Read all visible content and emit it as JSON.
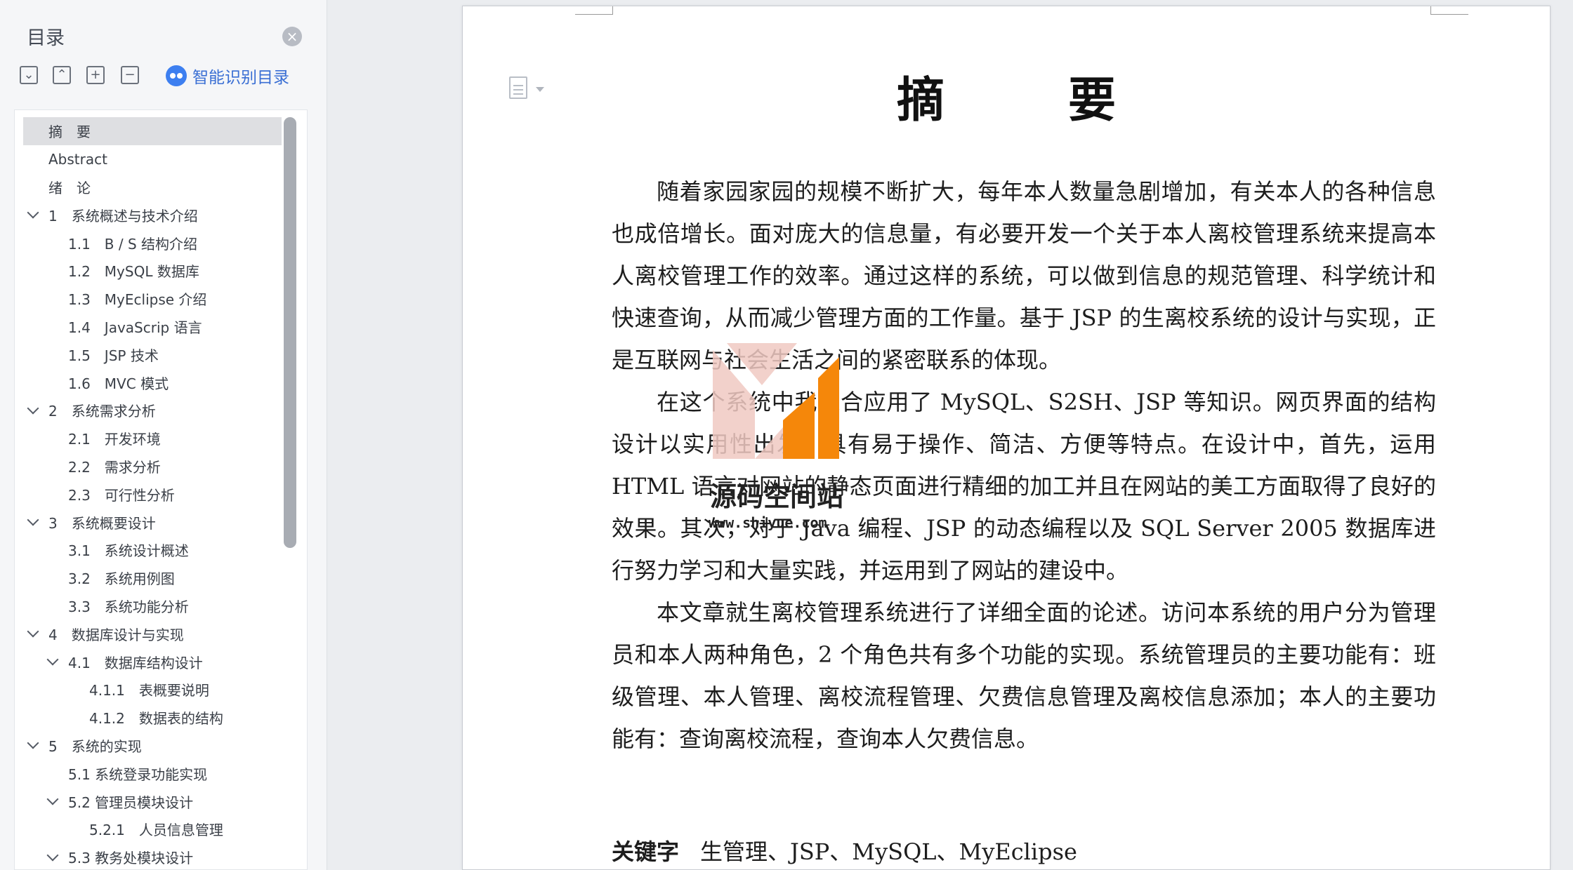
{
  "sidebar": {
    "title": "目录",
    "close_icon": "close-circle-icon",
    "tools": [
      {
        "name": "collapse-all-button",
        "glyph": "⌄"
      },
      {
        "name": "expand-all-button",
        "glyph": "⌃"
      },
      {
        "name": "zoom-in-button",
        "glyph": "+"
      },
      {
        "name": "zoom-out-button",
        "glyph": "−"
      }
    ],
    "smart_toc_label": "智能识别目录",
    "toc": [
      {
        "label": "摘　要",
        "level": 0,
        "chevron": false,
        "selected": true
      },
      {
        "label": "Abstract",
        "level": 0,
        "chevron": false
      },
      {
        "label": "绪　论",
        "level": 0,
        "chevron": false
      },
      {
        "label": "1　系统概述与技术介绍",
        "level": 0,
        "chevron": true
      },
      {
        "label": "1.1　B / S 结构介绍",
        "level": 1,
        "chevron": false
      },
      {
        "label": "1.2　MySQL 数据库",
        "level": 1,
        "chevron": false
      },
      {
        "label": "1.3　MyEclipse 介绍",
        "level": 1,
        "chevron": false
      },
      {
        "label": "1.4　JavaScrip 语言",
        "level": 1,
        "chevron": false
      },
      {
        "label": "1.5　JSP 技术",
        "level": 1,
        "chevron": false
      },
      {
        "label": "1.6　MVC 模式",
        "level": 1,
        "chevron": false
      },
      {
        "label": "2　系统需求分析",
        "level": 0,
        "chevron": true
      },
      {
        "label": "2.1　开发环境",
        "level": 1,
        "chevron": false
      },
      {
        "label": "2.2　需求分析",
        "level": 1,
        "chevron": false
      },
      {
        "label": "2.3　可行性分析",
        "level": 1,
        "chevron": false
      },
      {
        "label": "3　系统概要设计",
        "level": 0,
        "chevron": true
      },
      {
        "label": "3.1　系统设计概述",
        "level": 1,
        "chevron": false
      },
      {
        "label": "3.2　系统用例图",
        "level": 1,
        "chevron": false
      },
      {
        "label": "3.3　系统功能分析",
        "level": 1,
        "chevron": false
      },
      {
        "label": "4　数据库设计与实现",
        "level": 0,
        "chevron": true
      },
      {
        "label": "4.1　数据库结构设计",
        "level": 1,
        "chevron": true
      },
      {
        "label": "4.1.1　表概要说明",
        "level": 2,
        "chevron": false
      },
      {
        "label": "4.1.2　数据表的结构",
        "level": 2,
        "chevron": false
      },
      {
        "label": "5　系统的实现",
        "level": 0,
        "chevron": true
      },
      {
        "label": "5.1 系统登录功能实现",
        "level": 1,
        "chevron": false
      },
      {
        "label": "5.2 管理员模块设计",
        "level": 1,
        "chevron": true
      },
      {
        "label": "5.2.1　人员信息管理",
        "level": 2,
        "chevron": false
      },
      {
        "label": "5.3 教务处模块设计",
        "level": 1,
        "chevron": true
      }
    ]
  },
  "document": {
    "title": "摘　要",
    "paragraphs": [
      "随着家园家园的规模不断扩大，每年本人数量急剧增加，有关本人的各种信息也成倍增长。面对庞大的信息量，有必要开发一个关于本人离校管理系统来提高本人离校管理工作的效率。通过这样的系统，可以做到信息的规范管理、科学统计和快速查询，从而减少管理方面的工作量。基于 JSP 的生离校系统的设计与实现，正是互联网与社会生活之间的紧密联系的体现。",
      "在这个系统中我综合应用了 MySQL、S2SH、JSP 等知识。网页界面的结构设计以实用性出发，具有易于操作、简洁、方便等特点。在设计中，首先，运用 HTML 语言对网站的静态页面进行精细的加工并且在网站的美工方面取得了良好的效果。其次，对于 Java 编程、JSP 的动态编程以及 SQL Server 2005 数据库进行努力学习和大量实践，并运用到了网站的建设中。",
      "本文章就生离校管理系统进行了详细全面的论述。访问本系统的用户分为管理员和本人两种角色，2 个角色共有多个功能的实现。系统管理员的主要功能有：班级管理、本人管理、离校流程管理、欠费信息管理及离校信息添加；本人的主要功能有：查询离校流程，查询本人欠费信息。"
    ],
    "keywords_label": "关键字",
    "keywords": "生管理、JSP、MySQL、MyEclipse"
  },
  "watermark": {
    "name": "源码空间站",
    "url": "www.shiyue.com",
    "colors": {
      "orange": "#f5870a",
      "pink": "#f0c9c2"
    }
  }
}
